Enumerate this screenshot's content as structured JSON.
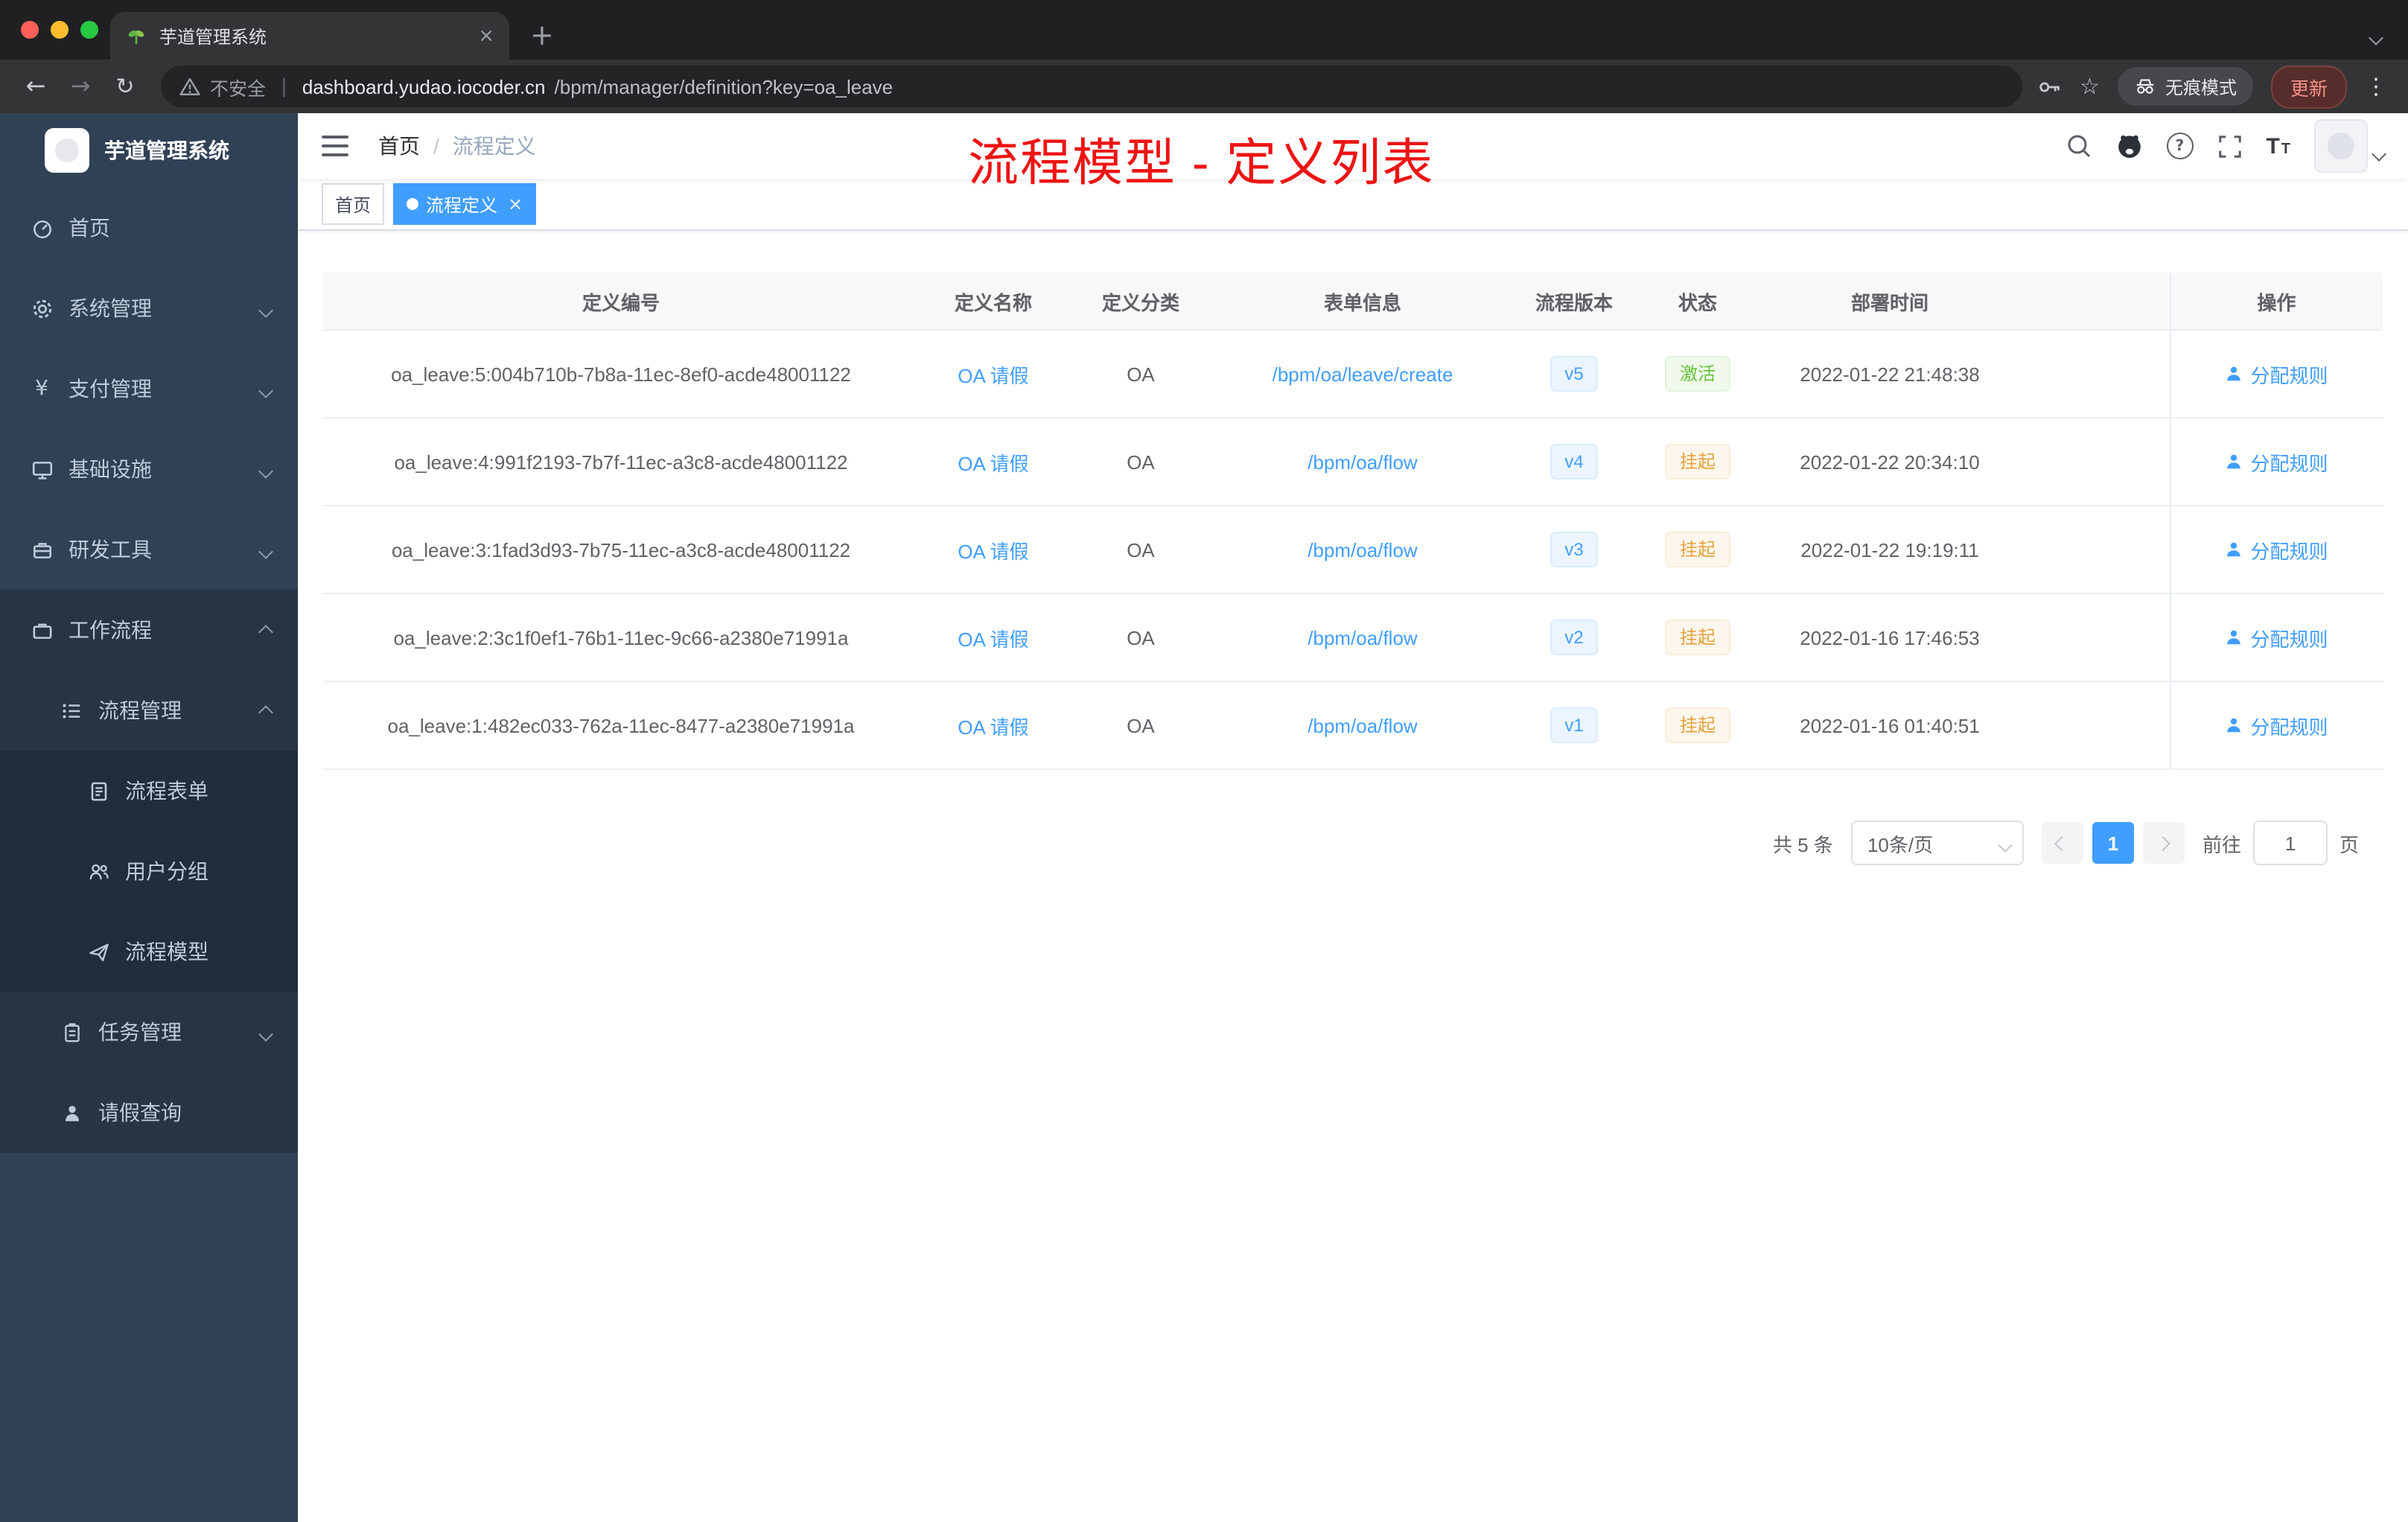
{
  "glyphs": {
    "back": "←",
    "forward": "→",
    "reload": "↻",
    "star": "☆",
    "kebab": "⋮",
    "close": "×",
    "plus": "+",
    "pipe": "|",
    "question": "?",
    "yen": "¥",
    "font_big": "T",
    "font_small": "T"
  },
  "theme": {
    "accent": "#409eff",
    "success": "#67c23a",
    "warning": "#e6a23c",
    "sidebar_bg": "#304156",
    "submenu_bg": "#1f2d3d",
    "annotation_red": "#ed1414",
    "traffic_lights": [
      "#ff5f57",
      "#febc2e",
      "#28c840"
    ]
  },
  "browser": {
    "tab_title": "芋道管理系统",
    "url_security": "不安全",
    "url_host": "dashboard.yudao.iocoder.cn",
    "url_path": "/bpm/manager/definition?key=oa_leave",
    "incognito_label": "无痕模式",
    "update_label": "更新"
  },
  "sidebar": {
    "title": "芋道管理系统",
    "items": [
      {
        "label": "首页",
        "icon": "dashboard-icon",
        "level": 0
      },
      {
        "label": "系统管理",
        "icon": "gear-icon",
        "level": 0,
        "chevron": "down"
      },
      {
        "label": "支付管理",
        "icon": "yen-icon",
        "level": 0,
        "chevron": "down"
      },
      {
        "label": "基础设施",
        "icon": "infrastructure-icon",
        "level": 0,
        "chevron": "down"
      },
      {
        "label": "研发工具",
        "icon": "devtools-icon",
        "level": 0,
        "chevron": "down"
      },
      {
        "label": "工作流程",
        "icon": "workflow-icon",
        "level": 0,
        "chevron": "up"
      },
      {
        "label": "流程管理",
        "icon": "process-list-icon",
        "level": 1,
        "chevron": "up"
      },
      {
        "label": "流程表单",
        "icon": "form-icon",
        "level": 2
      },
      {
        "label": "用户分组",
        "icon": "user-group-icon",
        "level": 2
      },
      {
        "label": "流程模型",
        "icon": "process-model-icon",
        "level": 2
      },
      {
        "label": "任务管理",
        "icon": "task-icon",
        "level": 1,
        "chevron": "down"
      },
      {
        "label": "请假查询",
        "icon": "leave-query-icon",
        "level": 1
      }
    ]
  },
  "navbar": {
    "breadcrumb_home": "首页",
    "breadcrumb_sep": "/",
    "breadcrumb_current": "流程定义"
  },
  "annotation": {
    "text": "流程模型 - 定义列表",
    "color": "#ed1414"
  },
  "tags": {
    "home": "首页",
    "active": "流程定义"
  },
  "table": {
    "columns": [
      "定义编号",
      "定义名称",
      "定义分类",
      "表单信息",
      "流程版本",
      "状态",
      "部署时间",
      "操作"
    ],
    "action_label": "分配规则",
    "rows": [
      {
        "id": "oa_leave:5:004b710b-7b8a-11ec-8ef0-acde48001122",
        "name": "OA 请假",
        "category": "OA",
        "form": "/bpm/oa/leave/create",
        "version": "v5",
        "status": "激活",
        "status_type": "success",
        "time": "2022-01-22 21:48:38"
      },
      {
        "id": "oa_leave:4:991f2193-7b7f-11ec-a3c8-acde48001122",
        "name": "OA 请假",
        "category": "OA",
        "form": "/bpm/oa/flow",
        "version": "v4",
        "status": "挂起",
        "status_type": "warning",
        "time": "2022-01-22 20:34:10"
      },
      {
        "id": "oa_leave:3:1fad3d93-7b75-11ec-a3c8-acde48001122",
        "name": "OA 请假",
        "category": "OA",
        "form": "/bpm/oa/flow",
        "version": "v3",
        "status": "挂起",
        "status_type": "warning",
        "time": "2022-01-22 19:19:11"
      },
      {
        "id": "oa_leave:2:3c1f0ef1-76b1-11ec-9c66-a2380e71991a",
        "name": "OA 请假",
        "category": "OA",
        "form": "/bpm/oa/flow",
        "version": "v2",
        "status": "挂起",
        "status_type": "warning",
        "time": "2022-01-16 17:46:53"
      },
      {
        "id": "oa_leave:1:482ec033-762a-11ec-8477-a2380e71991a",
        "name": "OA 请假",
        "category": "OA",
        "form": "/bpm/oa/flow",
        "version": "v1",
        "status": "挂起",
        "status_type": "warning",
        "time": "2022-01-16 01:40:51"
      }
    ]
  },
  "pagination": {
    "total": "共 5 条",
    "page_size": "10条/页",
    "page": "1",
    "goto": "前往",
    "goto_value": "1",
    "unit": "页"
  }
}
